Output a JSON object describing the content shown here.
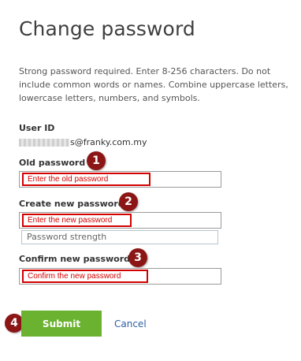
{
  "page": {
    "title": "Change password",
    "description": "Strong password required. Enter 8-256 characters. Do not include common words or names. Combine uppercase letters, lowercase letters, numbers, and symbols."
  },
  "user_id": {
    "label": "User ID",
    "value_suffix": "s@franky.com.my"
  },
  "old_password": {
    "label": "Old password",
    "annotation": "Enter the old password",
    "badge": "1"
  },
  "new_password": {
    "label": "Create new password",
    "annotation": "Enter the new password",
    "badge": "2",
    "strength_label": "Password strength"
  },
  "confirm_password": {
    "label": "Confirm new password",
    "annotation": "Confirm the new password",
    "badge": "3"
  },
  "actions": {
    "submit_label": "Submit",
    "submit_badge": "4",
    "cancel_label": "Cancel"
  },
  "colors": {
    "accent_green": "#6ab22f",
    "annotation_red": "#d40000",
    "badge_maroon": "#8c1616",
    "link_blue": "#2f5ea6"
  }
}
